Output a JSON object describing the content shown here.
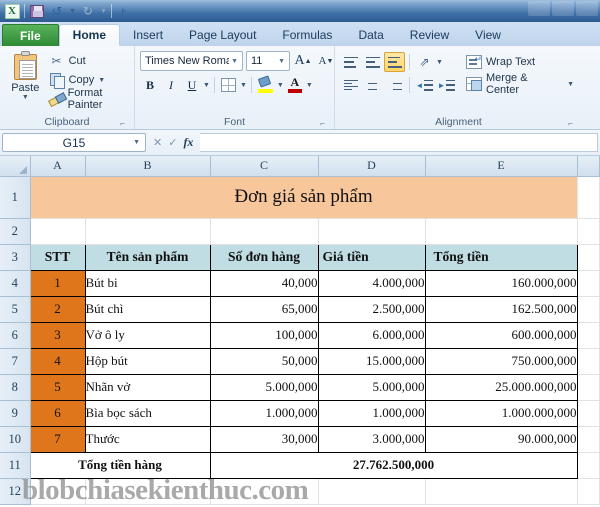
{
  "titlebar": {
    "app_icon": "excel-logo",
    "quick_access": [
      "save-icon",
      "undo-icon",
      "redo-icon",
      "customize-qat-icon"
    ]
  },
  "ribbon": {
    "tabs": [
      {
        "label": "File",
        "active": false,
        "kind": "file"
      },
      {
        "label": "Home",
        "active": true,
        "kind": "normal"
      },
      {
        "label": "Insert",
        "active": false,
        "kind": "normal"
      },
      {
        "label": "Page Layout",
        "active": false,
        "kind": "normal"
      },
      {
        "label": "Formulas",
        "active": false,
        "kind": "normal"
      },
      {
        "label": "Data",
        "active": false,
        "kind": "normal"
      },
      {
        "label": "Review",
        "active": false,
        "kind": "normal"
      },
      {
        "label": "View",
        "active": false,
        "kind": "normal"
      }
    ],
    "clipboard": {
      "group_label": "Clipboard",
      "paste_label": "Paste",
      "cut_label": "Cut",
      "copy_label": "Copy",
      "format_painter_label": "Format Painter"
    },
    "font": {
      "group_label": "Font",
      "font_name": "Times New Roman",
      "font_size": "11",
      "bold_label": "B",
      "italic_label": "I",
      "underline_label": "U",
      "grow_label": "A",
      "shrink_label": "A",
      "font_color_glyph": "A",
      "font_color_hex": "#c00000",
      "highlight_hex": "#ffff00"
    },
    "alignment": {
      "group_label": "Alignment",
      "wrap_text_label": "Wrap Text",
      "merge_center_label": "Merge & Center",
      "active_alignment": "center-vertical"
    }
  },
  "formula_bar": {
    "name_box": "G15",
    "formula_value": "",
    "fx_label": "fx"
  },
  "sheet": {
    "column_headers": [
      "A",
      "B",
      "C",
      "D",
      "E"
    ],
    "row_headers": [
      "1",
      "2",
      "3",
      "4",
      "5",
      "6",
      "7",
      "8",
      "9",
      "10",
      "11",
      "12"
    ],
    "title": "Đơn giá sản phẩm",
    "table_headers": [
      "STT",
      "Tên sản phẩm",
      "Số đơn hàng",
      "Giá tiền",
      "Tổng tiền"
    ],
    "rows": [
      {
        "stt": "1",
        "name": "Bút bi",
        "orders": "40,000",
        "price": "4.000,000",
        "total": "160.000,000"
      },
      {
        "stt": "2",
        "name": "Bút chì",
        "orders": "65,000",
        "price": "2.500,000",
        "total": "162.500,000"
      },
      {
        "stt": "3",
        "name": "Vở ô ly",
        "orders": "100,000",
        "price": "6.000,000",
        "total": "600.000,000"
      },
      {
        "stt": "4",
        "name": "Hộp bút",
        "orders": "50,000",
        "price": "15.000,000",
        "total": "750.000,000"
      },
      {
        "stt": "5",
        "name": "Nhãn vở",
        "orders": "5.000,000",
        "price": "5.000,000",
        "total": "25.000.000,000"
      },
      {
        "stt": "6",
        "name": "Bìa bọc sách",
        "orders": "1.000,000",
        "price": "1.000,000",
        "total": "1.000.000,000"
      },
      {
        "stt": "7",
        "name": "Thước",
        "orders": "30,000",
        "price": "3.000,000",
        "total": "90.000,000"
      }
    ],
    "footer": {
      "label": "Tổng tiền hàng",
      "value": "27.762.500,000"
    },
    "colors": {
      "title_fill": "#f7c69b",
      "header_fill": "#bfdde3",
      "stt_fill": "#e0761c"
    }
  },
  "watermark": "blobchiasekienthuc.com"
}
